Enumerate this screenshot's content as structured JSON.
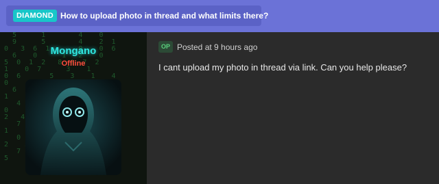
{
  "thread": {
    "badge": "DIAMOND",
    "title": "How to upload photo in thread and what limits there?"
  },
  "author": {
    "username": "Mongano",
    "status": "Offline",
    "avatar_icon": "hooded-figure-icon"
  },
  "post": {
    "op_label": "OP",
    "posted": "Posted at 9 hours ago",
    "message": "I cant upload my photo in thread via link. Can you help please?"
  },
  "colors": {
    "header": "#6b72d7",
    "badge": "#18c6c9",
    "username": "#2fe6e0",
    "status": "#ff4d3d",
    "op_badge": "#5ad17d"
  }
}
